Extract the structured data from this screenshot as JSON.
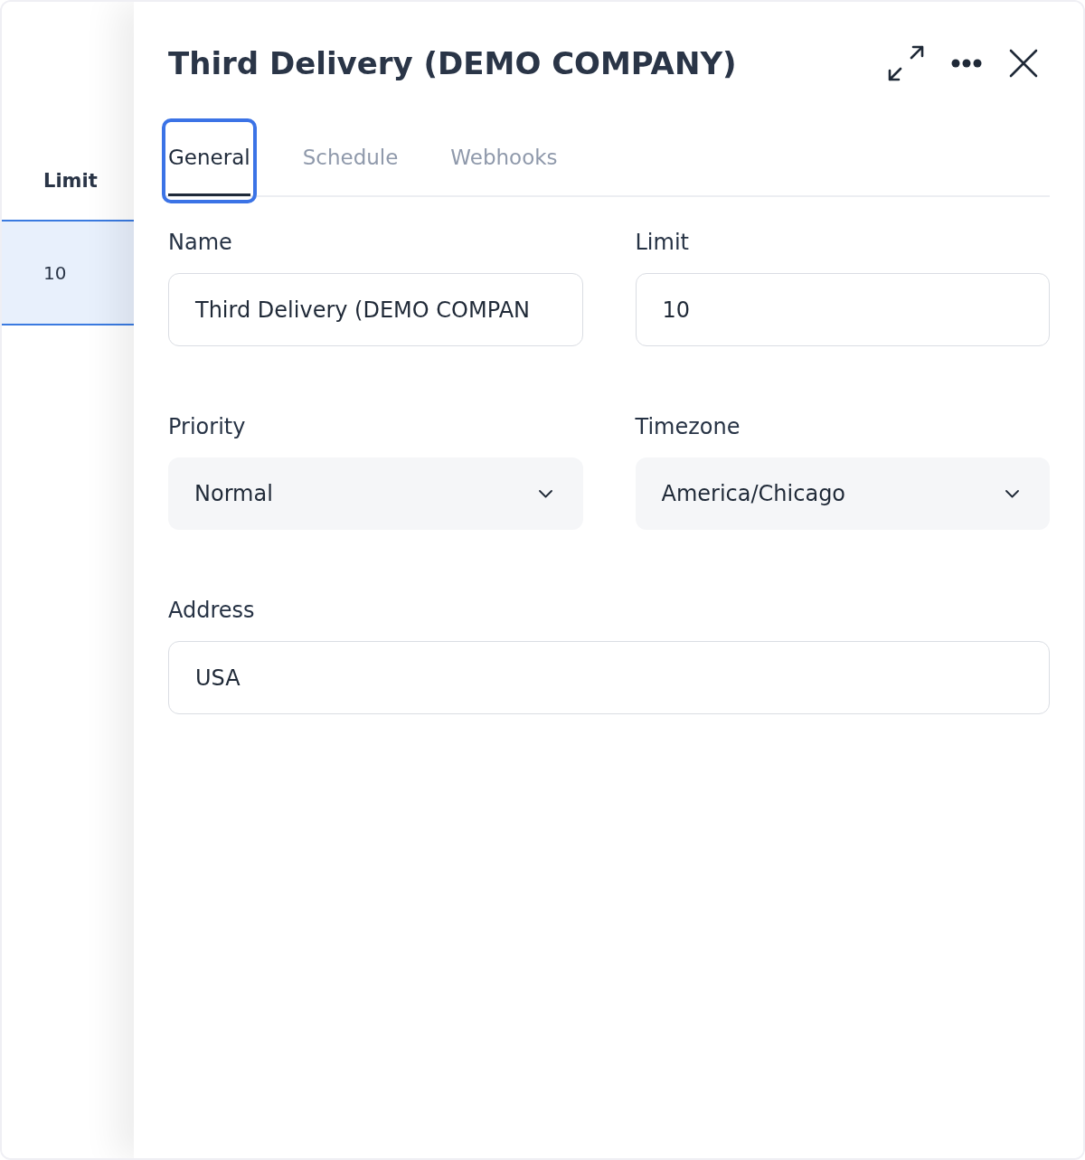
{
  "background_table": {
    "columns": [
      {
        "label": "Limit"
      }
    ],
    "rows": [
      {
        "selected": true,
        "cells": [
          "10"
        ]
      }
    ]
  },
  "panel": {
    "title": "Third Delivery (DEMO COMPANY)",
    "actions": [
      {
        "kind": "expand"
      },
      {
        "kind": "more"
      },
      {
        "kind": "close"
      }
    ],
    "tabs": [
      {
        "label": "General",
        "selected": true,
        "focused": true
      },
      {
        "label": "Schedule",
        "selected": false,
        "focused": false
      },
      {
        "label": "Webhooks",
        "selected": false,
        "focused": false
      }
    ],
    "form_rows": [
      [
        {
          "kind": "text",
          "label": "Name",
          "value": "Third Delivery (DEMO COMPAN"
        },
        {
          "kind": "text",
          "label": "Limit",
          "value": "10"
        }
      ],
      [
        {
          "kind": "select",
          "label": "Priority",
          "value": "Normal"
        },
        {
          "kind": "select",
          "label": "Timezone",
          "value": "America/Chicago"
        }
      ],
      [
        {
          "kind": "text",
          "label": "Address",
          "value": "USA"
        }
      ]
    ]
  }
}
